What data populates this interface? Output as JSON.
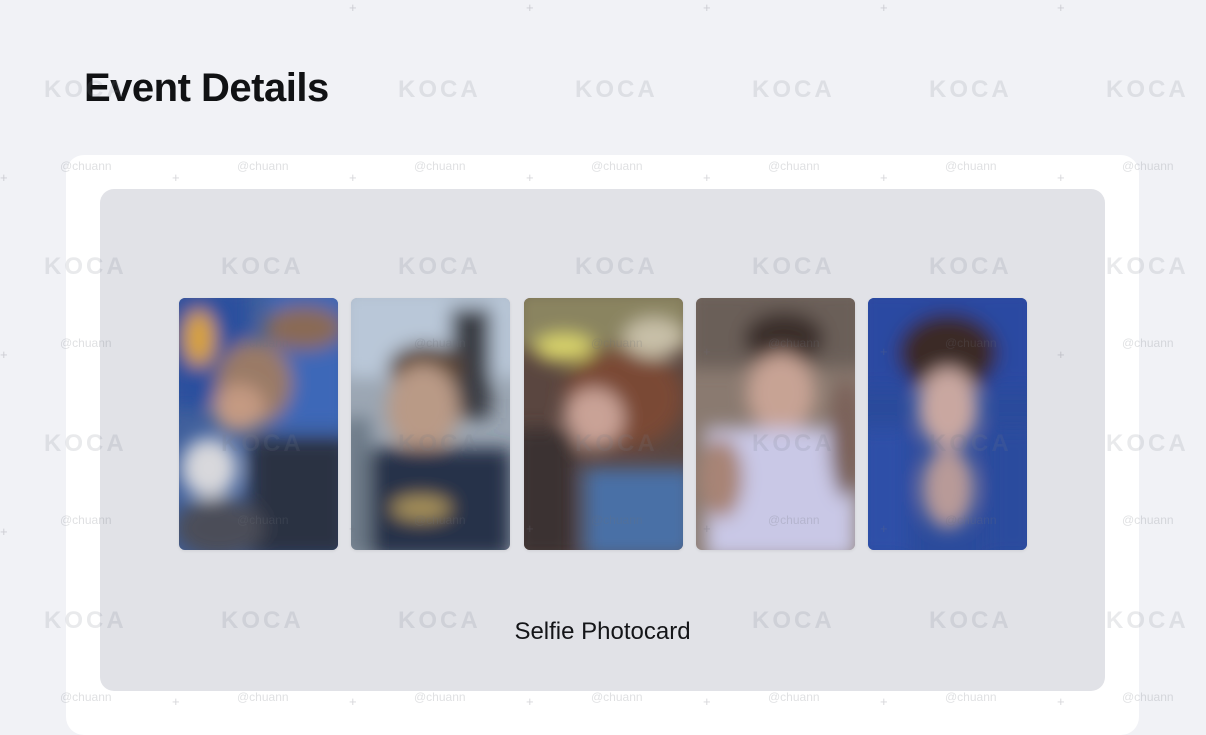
{
  "page": {
    "title": "Event Details"
  },
  "event": {
    "caption": "Selfie Photocard",
    "photocards": [
      {
        "name": "photocard-1"
      },
      {
        "name": "photocard-2"
      },
      {
        "name": "photocard-3"
      },
      {
        "name": "photocard-4"
      },
      {
        "name": "photocard-5"
      }
    ]
  },
  "watermark": {
    "logo": "KOCA",
    "handle": "@chuann"
  },
  "colors": {
    "page_background": "#f1f2f6",
    "card_background": "#ffffff",
    "panel_background": "#e1e2e7",
    "title_text": "#111214"
  }
}
